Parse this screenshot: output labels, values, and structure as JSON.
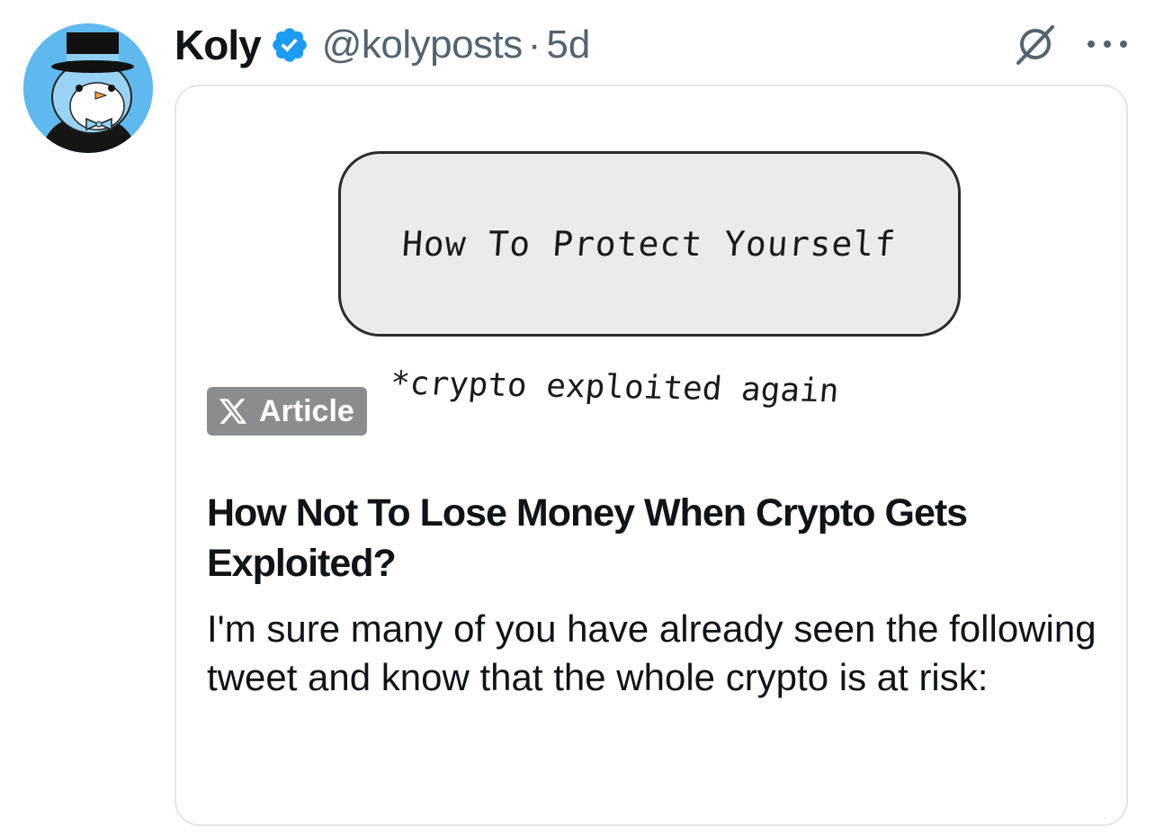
{
  "author": {
    "name": "Koly",
    "handle": "@kolyposts",
    "separator": "·",
    "timestamp": "5d",
    "verified": true,
    "avatar": "penguin-top-hat-avatar"
  },
  "actions": {
    "grok_icon": "grok-icon",
    "more_icon": "more-options-icon"
  },
  "article": {
    "cover": {
      "banner_text": "How To Protect Yourself",
      "note_text": "*crypto exploited again"
    },
    "badge_label": "Article",
    "title": "How Not To Lose Money When Crypto Gets Exploited?",
    "excerpt": "I'm sure many of you have already seen the following tweet and know that the whole crypto is at risk:"
  },
  "colors": {
    "text_primary": "#0f1419",
    "text_secondary": "#536471",
    "verified_blue": "#1d9bf0",
    "badge_gray": "#8a8d90",
    "card_border": "#e3e6e8"
  }
}
